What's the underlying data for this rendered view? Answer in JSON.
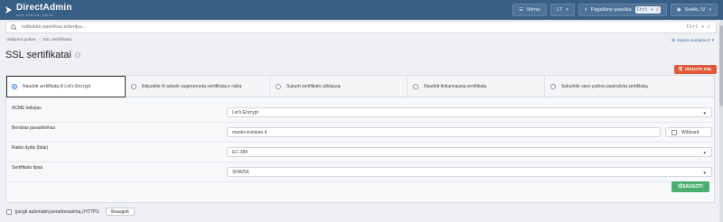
{
  "app": {
    "name": "DirectAdmin",
    "tagline": "web control panel"
  },
  "topbar": {
    "menu_label": "Meniu",
    "language": "LT",
    "help_label": "Pagalbinė paieška",
    "help_shortcut": "Ctrl + /",
    "user_label": "Sveiki, IV"
  },
  "search": {
    "placeholder": "Ieškokite paieškos kriterijus...",
    "shortcut": "Ctrl + /"
  },
  "breadcrumb": [
    "Valdymo pultas",
    "SSL sertifikatai"
  ],
  "user_link": "manto-svetaine.lt",
  "page_title": "SSL sertifikatai",
  "issue_button": "IŠDUOTI SSL",
  "tabs": [
    {
      "label": "Naudoti sertifikatą iš Let's Encrypt",
      "active": true
    },
    {
      "label": "Įklijuokite iš anksto sugeneruotą sertifikatą ir raktą",
      "active": false
    },
    {
      "label": "Sukurti sertifikato užklausą",
      "active": false
    },
    {
      "label": "Naudoti tinkamiausią sertifikatą",
      "active": false
    },
    {
      "label": "Sukurkite savo pačios pasirašytą sertifikatą",
      "active": false
    }
  ],
  "form": {
    "acme_label": "ACME teikėjas",
    "acme_value": "Let's Encrypt",
    "cn_label": "Bendras pavadinimas",
    "cn_value": "manto-svetaine.lt",
    "wildcard_label": "Wildcard",
    "key_label": "Rakto dydis (bitai)",
    "key_value": "EC-384",
    "sig_label": "Sertifikato tipas",
    "sig_value": "SHA256",
    "save_label": "IŠSAUGOTI"
  },
  "redirect": {
    "label": "Įjungti automatinį peradresavimą į HTTPS",
    "save_label": "Išsaugoti"
  },
  "colors": {
    "topbar": "#3a5f86",
    "issue": "#e05a3a",
    "save": "#4caf72",
    "accent": "#2b7de9"
  },
  "icons": [
    "directadmin-logo-icon",
    "search-icon",
    "menu-icon",
    "language-icon",
    "help-icon",
    "user-icon",
    "key-icon",
    "chevron-down-icon",
    "external-link-icon"
  ]
}
